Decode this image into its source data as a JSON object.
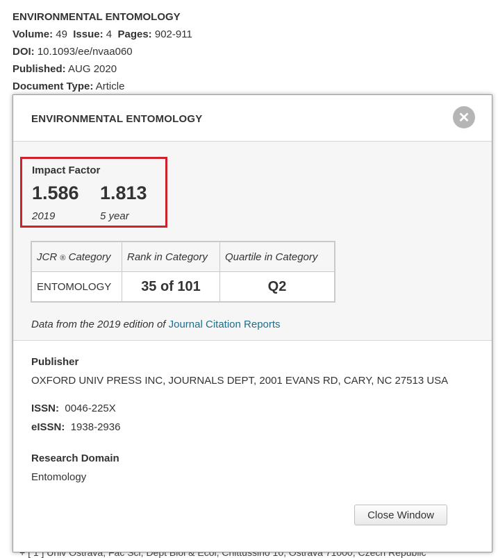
{
  "background": {
    "journal_title": "ENVIRONMENTAL ENTOMOLOGY",
    "volume_label": "Volume:",
    "volume": "49",
    "issue_label": "Issue:",
    "issue": "4",
    "pages_label": "Pages:",
    "pages": "902-911",
    "doi_label": "DOI:",
    "doi": "10.1093/ee/nvaa060",
    "published_label": "Published:",
    "published": "AUG 2020",
    "doctype_label": "Document Type:",
    "doctype": "Article",
    "bottom_text": "+   [ 1 ] Univ Ostrava, Fac Sci, Dept Biol & Ecol, Chittussiho 10, Ostrava 71000, Czech Republic"
  },
  "modal": {
    "title": "ENVIRONMENTAL ENTOMOLOGY",
    "close_icon": "close-icon",
    "impact_factor": {
      "label": "Impact Factor",
      "value_2019": "1.586",
      "year_label": "2019",
      "value_5yr": "1.813",
      "five_year_label": "5 year"
    },
    "table": {
      "headers": [
        "JCR",
        "Category",
        "Rank in Category",
        "Quartile in Category"
      ],
      "reg_mark": "®",
      "row": {
        "category": "ENTOMOLOGY",
        "rank": "35 of 101",
        "quartile": "Q2"
      }
    },
    "data_note": "Data from the 2019 edition of ",
    "data_link": "Journal Citation Reports",
    "publisher_label": "Publisher",
    "publisher": "OXFORD UNIV PRESS INC, JOURNALS DEPT, 2001 EVANS RD, CARY, NC 27513 USA",
    "issn_label": "ISSN:",
    "issn": "0046-225X",
    "eissn_label": "eISSN:",
    "eissn": "1938-2936",
    "research_domain_label": "Research Domain",
    "research_domain": "Entomology",
    "close_button": "Close Window"
  },
  "colors": {
    "highlight_border": "#d0212a",
    "link": "#1d6e8a"
  }
}
